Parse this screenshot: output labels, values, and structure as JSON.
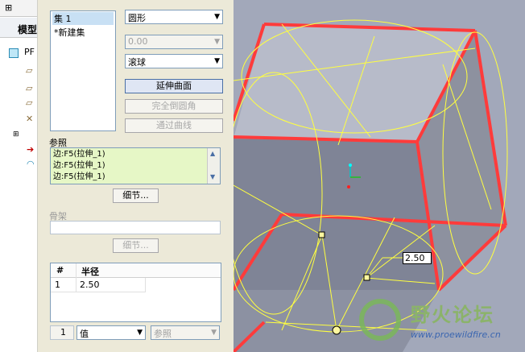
{
  "model_tree": {
    "tab_label": "模型",
    "root_label": "PF"
  },
  "panel": {
    "sets": {
      "items": [
        "集 1",
        "*新建集"
      ]
    },
    "shape_combo": {
      "value": "圆形"
    },
    "value_combo": {
      "value": "0.00"
    },
    "method_combo": {
      "value": "滚球"
    },
    "buttons": {
      "extend_surface": "延伸曲面",
      "full_round": "完全倒圆角",
      "through_curve": "通过曲线"
    },
    "references": {
      "label": "参照",
      "items": [
        "边:F5(拉伸_1)",
        "边:F5(拉伸_1)",
        "边:F5(拉伸_1)"
      ]
    },
    "details_button_1": "细节...",
    "spine": {
      "label": "骨架",
      "details_button": "细节..."
    },
    "radius_table": {
      "headers": [
        "#",
        "半径"
      ],
      "rows": [
        [
          "1",
          "2.50"
        ]
      ]
    },
    "bottom": {
      "index": "1",
      "value_mode": "值",
      "reference": "参照"
    }
  },
  "viewport": {
    "dimension_label": "2.50",
    "watermark_title": "野火论坛",
    "watermark_url": "www.proewildfire.cn"
  },
  "colors": {
    "viewport_bg": "#a2a8ba",
    "edge_highlight": "#ff3b3b",
    "wireframe": "#ffff40",
    "panel_bg": "#ece9d8",
    "active_button": "#dfe6f4",
    "references_bg": "#e6f7c6"
  }
}
